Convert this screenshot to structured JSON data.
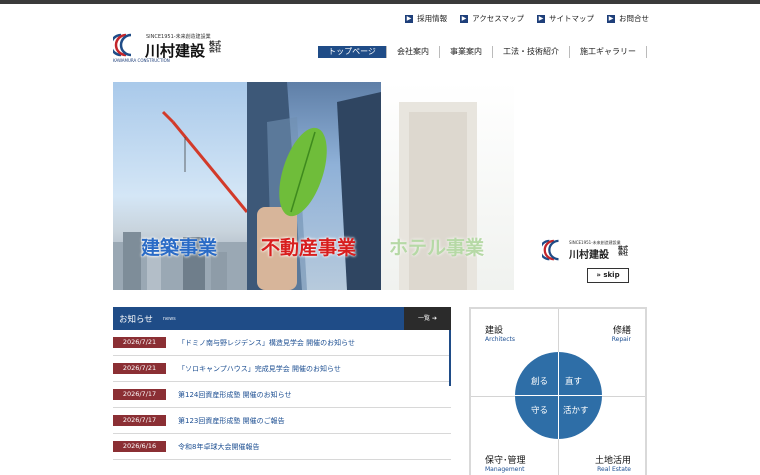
{
  "header": {
    "util_links": [
      {
        "label": "採用情報",
        "icon": "arrow-square-icon"
      },
      {
        "label": "アクセスマップ",
        "icon": "arrow-square-icon"
      },
      {
        "label": "サイトマップ",
        "icon": "arrow-square-icon"
      },
      {
        "label": "お問合せ",
        "icon": "arrow-square-icon"
      }
    ],
    "logo": {
      "since": "SINCE1951-未来創造建設業",
      "name": "川村建設",
      "kaisha": "株式会社",
      "sub": "KAWAMURA CONSTRUCTION"
    },
    "nav": [
      {
        "label": "トップページ",
        "active": true
      },
      {
        "label": "会社案内"
      },
      {
        "label": "事業案内"
      },
      {
        "label": "工法・技術紹介"
      },
      {
        "label": "施工ギャラリー"
      }
    ]
  },
  "hero": {
    "captions": [
      "建築事業",
      "不動産事業",
      "ホテル事業"
    ],
    "skip_logo": {
      "since": "SINCE1951-未来創造建設業",
      "name": "川村建設",
      "kaisha": "株式会社",
      "sub": "KAWAMURA"
    },
    "skip_label": "» skip"
  },
  "news": {
    "title": "お知らせ",
    "title_en": "news",
    "more_label": "一覧 ➔",
    "items": [
      {
        "date": "2026/7/21",
        "title": "「ドミノ南与野レジデンス」構造見学会 開催のお知らせ"
      },
      {
        "date": "2026/7/21",
        "title": "「ソロキャンプハウス」完成見学会 開催のお知らせ"
      },
      {
        "date": "2026/7/17",
        "title": "第124回資産形成塾 開催のお知らせ"
      },
      {
        "date": "2026/7/17",
        "title": "第123回資産形成塾 開催のご報告"
      },
      {
        "date": "2026/6/16",
        "title": "令和8年卓球大会開催報告"
      }
    ]
  },
  "services": {
    "quadrants": [
      {
        "label": "建設",
        "en": "Architects"
      },
      {
        "label": "修繕",
        "en": "Repair"
      },
      {
        "label": "保守･管理",
        "en": "Management"
      },
      {
        "label": "土地活用",
        "en": "Real Estate"
      }
    ],
    "circle": [
      "創る",
      "直す",
      "守る",
      "活かす"
    ]
  },
  "colors": {
    "brand_blue": "#1f4c87",
    "news_date": "#8b2f34",
    "circle_blue": "#2e6ea7"
  }
}
